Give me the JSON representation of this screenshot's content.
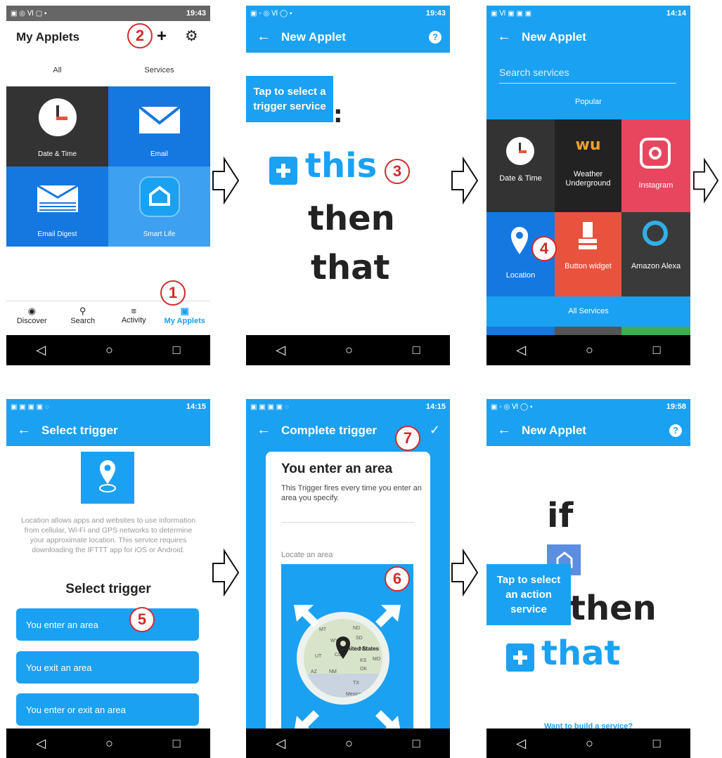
{
  "panel1": {
    "status_time": "19:43",
    "title": "My Applets",
    "tabs": [
      "All",
      "Services"
    ],
    "tiles": [
      "Date & Time",
      "Email",
      "Email Digest",
      "Smart Life"
    ],
    "bottom_nav": [
      "Discover",
      "Search",
      "Activity",
      "My Applets"
    ],
    "marker_add": "2",
    "marker_nav": "1"
  },
  "panel2": {
    "status_time": "19:43",
    "title": "New Applet",
    "callout": "Tap to select a trigger service",
    "word_this": "this",
    "word_then": "then",
    "word_that": "that",
    "marker": "3"
  },
  "panel3": {
    "status_time": "14:14",
    "title": "New Applet",
    "search_placeholder": "Search services",
    "section": "Popular",
    "tiles": [
      "Date & Time",
      "Weather Underground",
      "Instagram",
      "Location",
      "Button widget",
      "Amazon Alexa"
    ],
    "all_services": "All Services",
    "marker": "4"
  },
  "panel4": {
    "status_time": "14:15",
    "title": "Select trigger",
    "description": "Location allows apps and websites to use information from cellular, Wi-Fi and GPS networks to determine your approximate location. This service requires downloading the IFTTT app for iOS or Android.",
    "heading": "Select trigger",
    "options": [
      "You enter an area",
      "You exit an area",
      "You enter or exit an area"
    ],
    "marker": "5"
  },
  "panel5": {
    "status_time": "14:15",
    "title": "Complete trigger",
    "card_title": "You enter an area",
    "card_desc": "This Trigger fires every time you enter an area you specify.",
    "field_label": "Locate an area",
    "map_states": [
      "MT",
      "ND",
      "WY",
      "SD",
      "NE",
      "UT",
      "CO",
      "KS",
      "MO",
      "AZ",
      "NM",
      "OK",
      "TX",
      "United States",
      "Mexico"
    ],
    "marker_map": "6",
    "marker_check": "7"
  },
  "panel6": {
    "status_time": "19:58",
    "title": "New Applet",
    "word_if": "if",
    "word_then": "then",
    "word_that": "that",
    "callout": "Tap to select an action service",
    "footer_link": "Want to build a service?"
  },
  "colors": {
    "accent": "#1ba1f2",
    "marker": "#d42a2a",
    "ink": "#222222"
  }
}
